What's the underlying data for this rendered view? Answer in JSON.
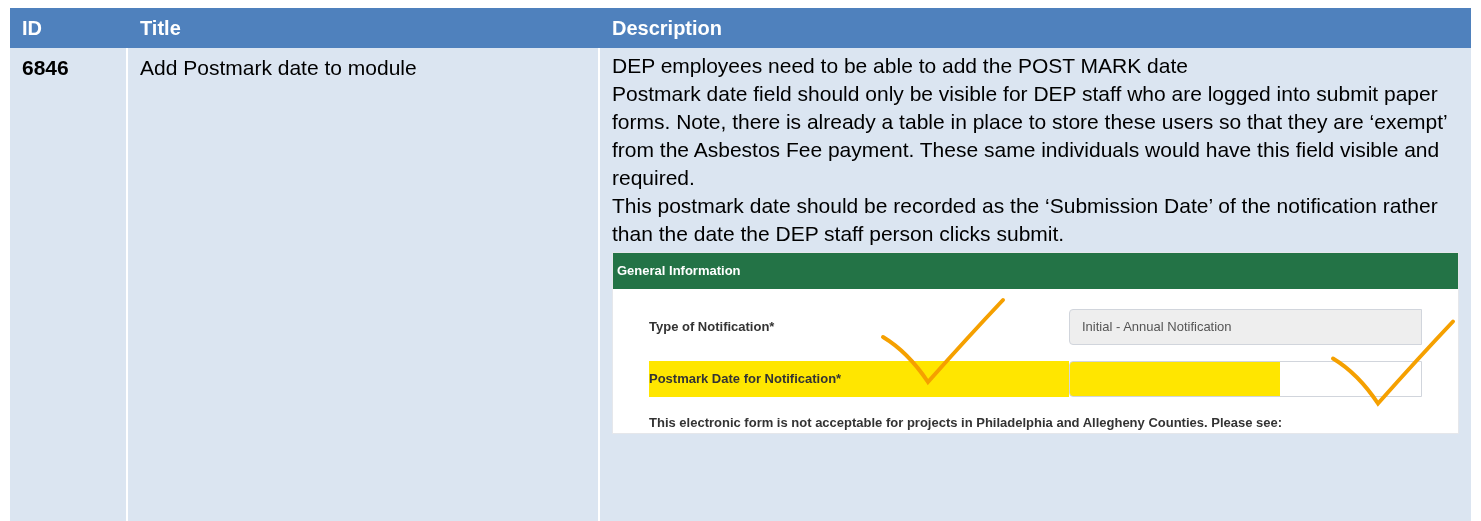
{
  "table": {
    "columns": [
      "ID",
      "Title",
      "Description"
    ],
    "rows": [
      {
        "id": "6846",
        "title": "Add Postmark date to module",
        "description": [
          "DEP employees need to be able to add the POST MARK date",
          "Postmark date field should only be visible for DEP staff who are logged into submit paper forms. Note, there is already a table in place to store these users so that they are ‘exempt’ from the Asbestos Fee payment. These same individuals would have this field visible and required.",
          "This postmark date should be recorded as the ‘Submission Date’ of the notification rather than the date the DEP staff person clicks submit."
        ],
        "screenshot": {
          "header": "General Information",
          "fields": [
            {
              "label": "Type of Notification*",
              "value": "Initial - Annual Notification",
              "highlighted": false
            },
            {
              "label": "Postmark Date for Notification*",
              "highlighted": true
            }
          ],
          "note": "This electronic form is not acceptable for projects in Philadelphia and Allegheny Counties. Please see:"
        }
      }
    ]
  }
}
